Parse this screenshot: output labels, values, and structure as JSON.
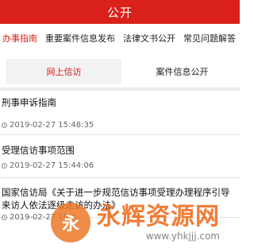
{
  "header": {
    "title": "公开"
  },
  "categories": [
    {
      "label": "办事指南",
      "active": true
    },
    {
      "label": "重要案件信息发布",
      "active": false
    },
    {
      "label": "法律文书公开",
      "active": false
    },
    {
      "label": "常见问题解答",
      "active": false
    }
  ],
  "sub_tabs": [
    {
      "label": "网上信访",
      "active": true
    },
    {
      "label": "案件信息公开",
      "active": false
    }
  ],
  "items": [
    {
      "title": "刑事申诉指南",
      "date": "2019-02-27 15:48:35"
    },
    {
      "title": "受理信访事项范围",
      "date": "2019-02-27 15:44:06"
    },
    {
      "title": "国家信访局《关于进一步规范信访事项受理办理程序引导来访人依法逐级走访的办法》",
      "date": "2019-02-27 15:4"
    }
  ],
  "watermark": {
    "title": "永辉资源网",
    "url": "www.yhkjjj.com",
    "logo_glyph": "永"
  },
  "colors": {
    "accent": "#d9201b",
    "header_bg": "#d9201b"
  },
  "icons": {
    "date_icon": "clock-icon"
  }
}
